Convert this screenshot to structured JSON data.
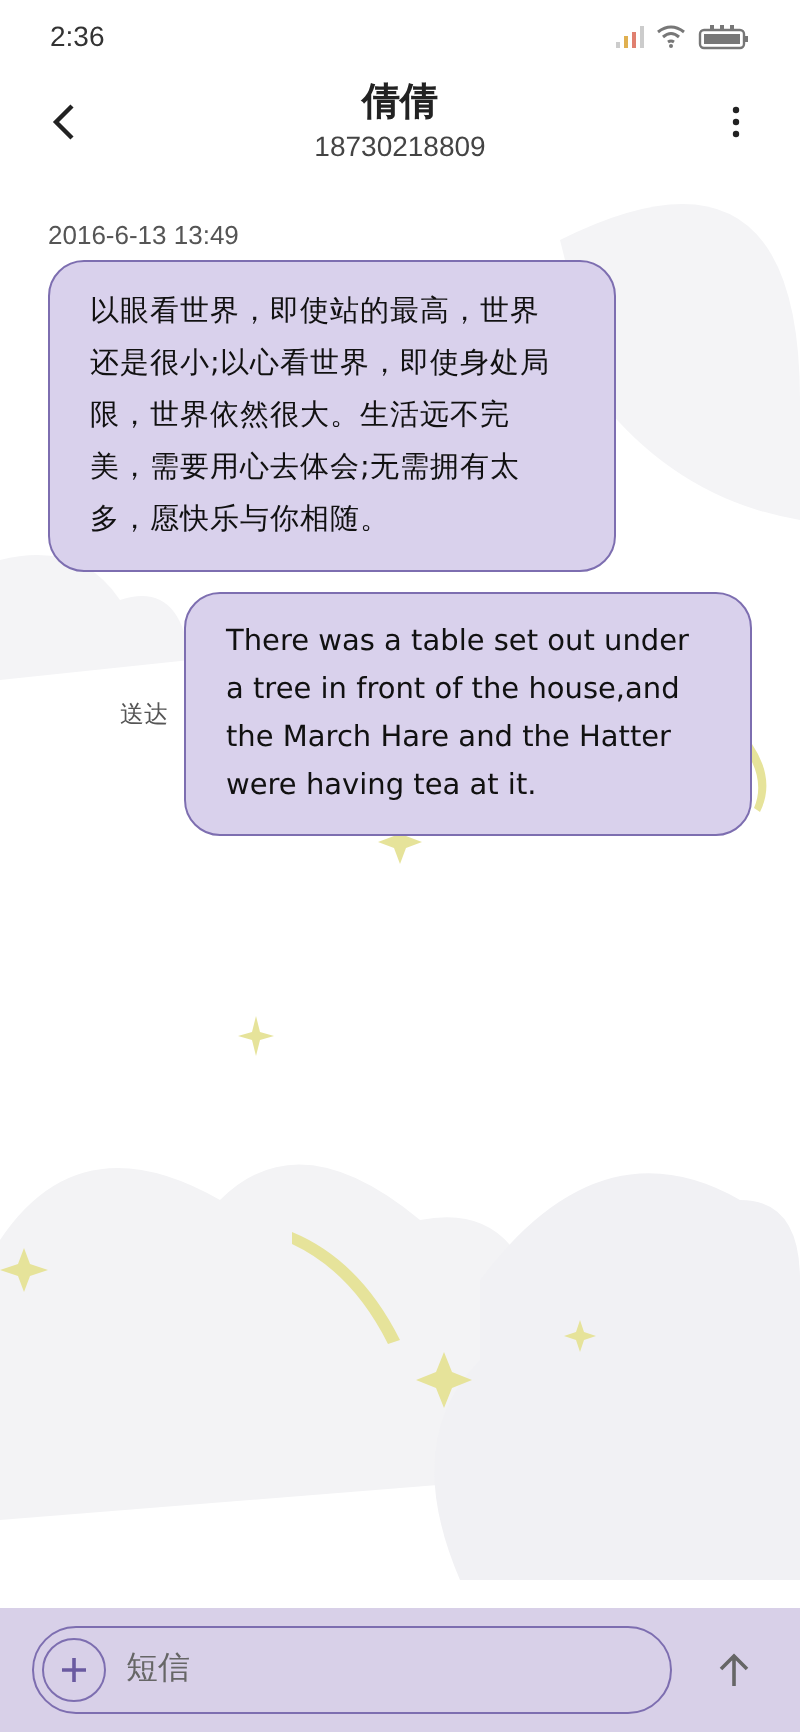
{
  "status_bar": {
    "time": "2:36"
  },
  "header": {
    "title": "倩倩",
    "subtitle": "18730218809"
  },
  "timestamp": "2016-6-13 13:49",
  "messages": [
    {
      "kind": "incoming",
      "text": "以眼看世界，即使站的最高，世界还是很小;以心看世界，即使身处局限，世界依然很大。生活远不完美，需要用心去体会;无需拥有太多，愿快乐与你相随。"
    },
    {
      "kind": "outgoing",
      "text": "There was a table set out under a tree in front of the house,and the March Hare and the Hatter were having tea at it.",
      "status": "送达"
    }
  ],
  "composer": {
    "placeholder": "短信"
  }
}
